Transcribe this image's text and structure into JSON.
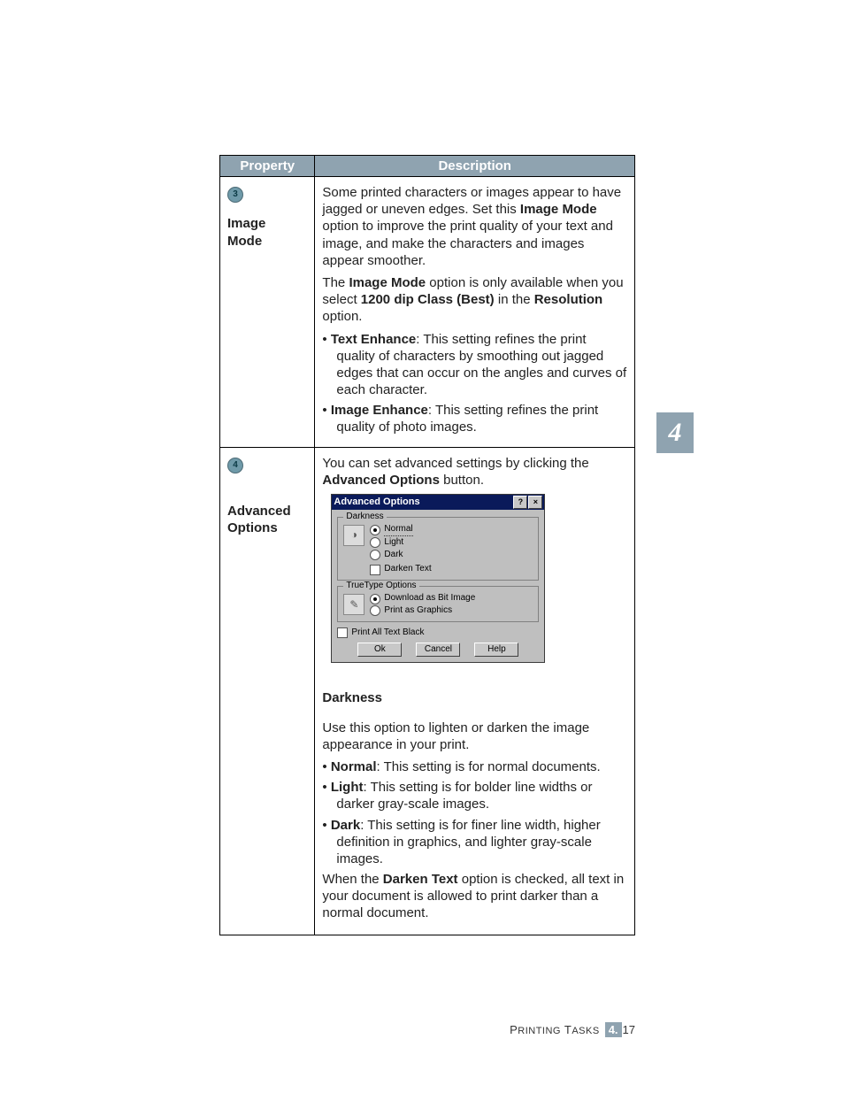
{
  "table": {
    "header_property": "Property",
    "header_description": "Description"
  },
  "row1": {
    "badge": "3",
    "name_l1": "Image",
    "name_l2": "Mode",
    "p1a": "Some printed characters or images appear to have jagged or uneven edges. Set this ",
    "p1b_bold": "Image Mode",
    "p1c": " option to improve the print quality of your text and image, and make the characters and images appear smoother.",
    "p2a": "The ",
    "p2b_bold": "Image Mode",
    "p2c": " option is only available when you select ",
    "p2d_bold": "1200 dip Class (Best)",
    "p2e": " in the ",
    "p2f_bold": "Resolution",
    "p2g": " option.",
    "b1_bold": "Text Enhance",
    "b1_rest": ": This setting refines the print quality of characters by smoothing out jagged edges that can occur on the angles and curves of each character.",
    "b2_bold": "Image Enhance",
    "b2_rest": ": This setting refines the print quality of photo images."
  },
  "row2": {
    "badge": "4",
    "name_l1": "Advanced",
    "name_l2": "Options",
    "intro_a": "You can set advanced settings by clicking the ",
    "intro_b_bold": "Advanced Options",
    "intro_c": " button.",
    "dialog": {
      "title": "Advanced Options",
      "help_btn": "?",
      "close_btn": "×",
      "darkness_legend": "Darkness",
      "opt_normal": "Normal",
      "opt_light": "Light",
      "opt_dark": "Dark",
      "chk_darken_text": "Darken Text",
      "tt_legend": "TrueType Options",
      "tt_opt1": "Download as Bit Image",
      "tt_opt2": "Print as Graphics",
      "chk_print_black": "Print All Text Black",
      "btn_ok": "Ok",
      "btn_cancel": "Cancel",
      "btn_help": "Help"
    },
    "darkness_heading": "Darkness",
    "darkness_p": "Use this option to lighten or darken the image appearance in your print.",
    "db1_bold": "Normal",
    "db1_rest": ": This setting is for normal documents.",
    "db2_bold": "Light",
    "db2_rest": ": This setting is for bolder line widths or darker gray-scale images.",
    "db3_bold": "Dark",
    "db3_rest": ": This setting is for finer line width, higher definition in graphics, and lighter gray-scale images.",
    "tail_a": "When the ",
    "tail_b_bold": "Darken Text",
    "tail_c": " option is checked, all text in your document is allowed to print darker than a normal document."
  },
  "chapter_tab": "4",
  "footer": {
    "section_word_1": "P",
    "section_word_rest_1": "RINTING",
    "section_word_2": "T",
    "section_word_rest_2": "ASKS",
    "badge": "4.",
    "pagenum": "17"
  }
}
